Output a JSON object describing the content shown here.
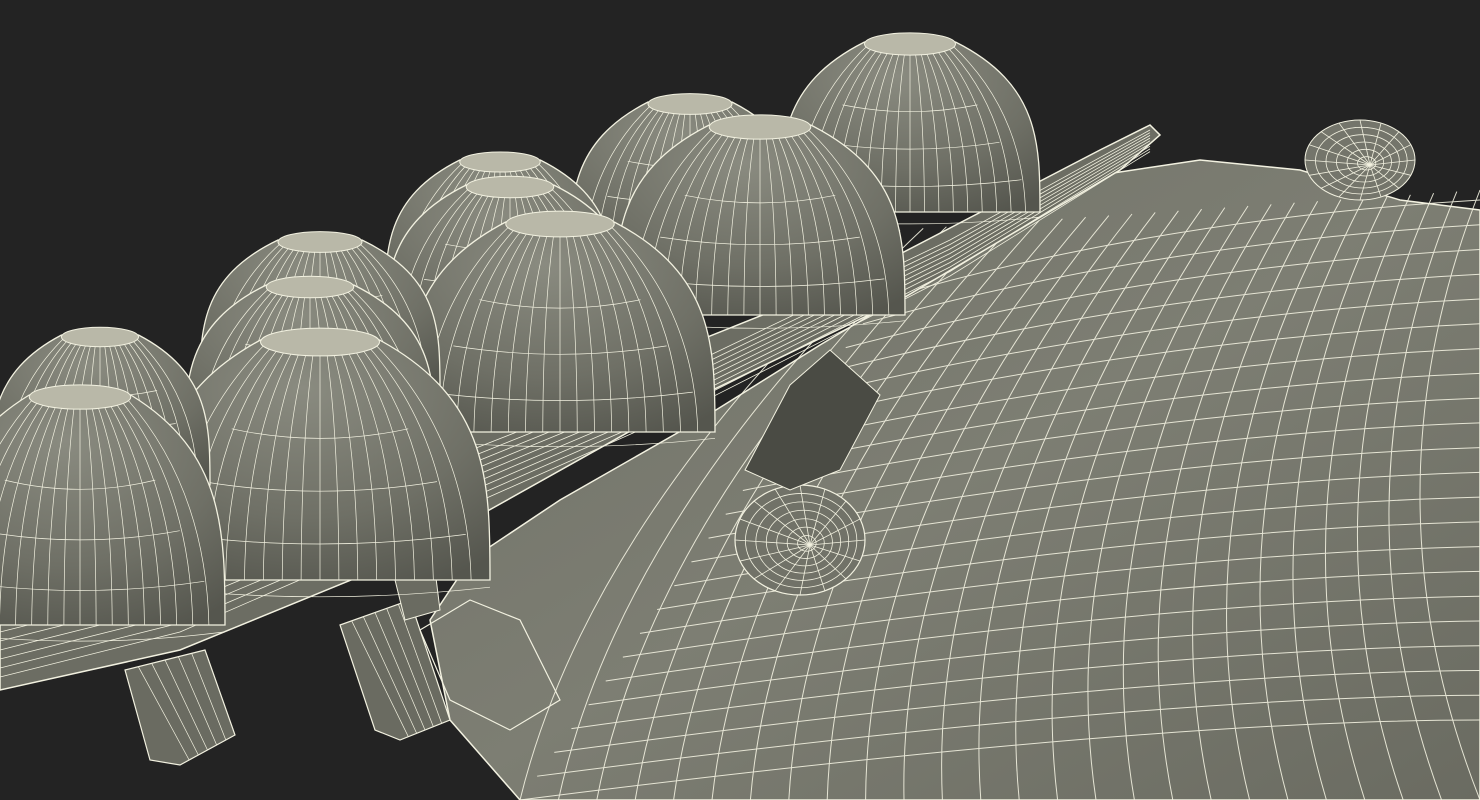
{
  "scene": {
    "subject": "wireframe-3d-model-render",
    "background_color": "#232323",
    "surface_color": "#7c7d72",
    "surface_shadow_color": "#5f6057",
    "wire_color": "#f2f1e0"
  }
}
